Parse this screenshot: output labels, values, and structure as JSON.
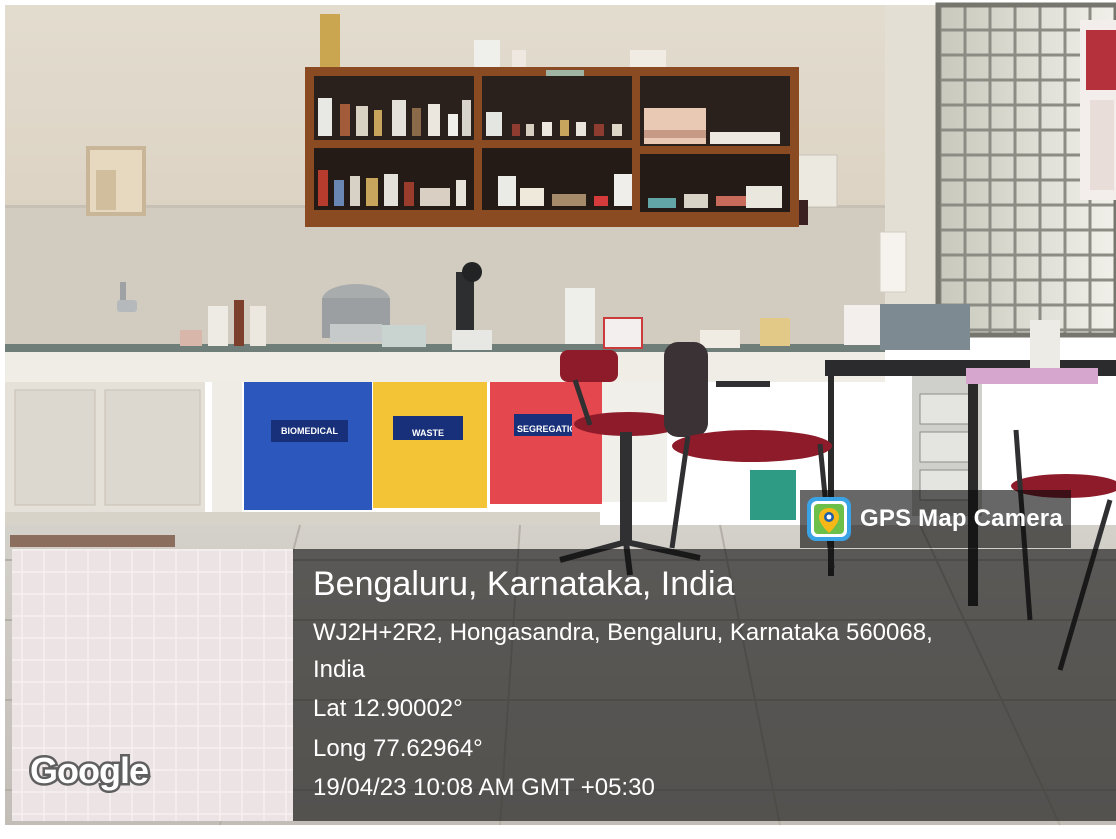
{
  "photo": {
    "cabinet_labels": [
      "BIOMEDICAL",
      "WASTE",
      "SEGREGATION"
    ],
    "colors": {
      "blue_cabinet": "#2c58bd",
      "yellow_cabinet": "#f2c436",
      "red_cabinet": "#e4484e",
      "chair_red": "#8e1b2a",
      "wall": "#e9e1d5",
      "shelf_wood": "#8a4b22"
    }
  },
  "overlay": {
    "app_badge": "GPS Map Camera",
    "app_icon": "gps-map-camera-icon",
    "map_logo": "Google",
    "location_title": "Bengaluru, Karnataka, India",
    "address_line1": "WJ2H+2R2, Hongasandra, Bengaluru, Karnataka 560068,",
    "address_line2": "India",
    "latitude": "Lat 12.90002°",
    "longitude": "Long 77.62964°",
    "datetime": "19/04/23 10:08 AM GMT +05:30"
  }
}
